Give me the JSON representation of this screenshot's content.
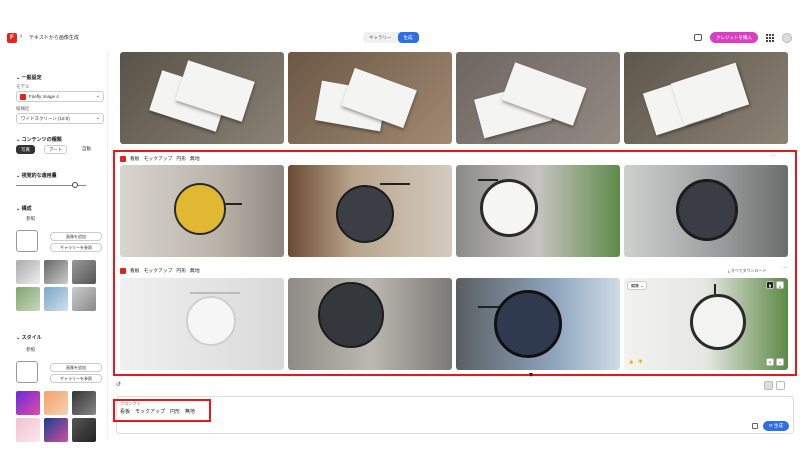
{
  "header": {
    "logo_text": "F",
    "back_icon": "chevron-left-icon",
    "title": "テキストから画像生成",
    "tabs": [
      "ギャラリー",
      "生成"
    ],
    "active_tab": "生成",
    "buy_credits": "クレジットを購入",
    "brand_color": "#e1251b",
    "accent_color": "#2f6fe4",
    "buy_color": "#d93fc2"
  },
  "sidebar": {
    "general_heading": "一般設定",
    "model_label": "モデル",
    "model_value": "Firefly Image 4",
    "aspect_label": "縦横比",
    "aspect_value": "ワイドスクリーン (16:9)",
    "content_heading": "コンテンツの種類",
    "content_options": [
      "写真",
      "アート",
      "自動"
    ],
    "visual_heading": "視覚的な適用量",
    "composition_heading": "構成",
    "composition_mode": "参照",
    "upload_btn": "画像を追加",
    "gallery_btn": "ギャラリーを参照",
    "style_heading": "スタイル",
    "style_mode": "参照",
    "style_upload_btn": "画像を追加",
    "style_gallery_btn": "ギャラリーを参照"
  },
  "main": {
    "row1_tags": [
      "看板",
      "モックアップ",
      "円形",
      "無地"
    ],
    "row2_tags": [
      "看板",
      "モックアップ",
      "円形",
      "無地"
    ],
    "download_all": "すべてダウンロード",
    "edit_label": "編集"
  },
  "prompt": {
    "label": "プロンプト",
    "text": "看板　モックアップ　円形　無地",
    "generate_btn": "生成"
  }
}
